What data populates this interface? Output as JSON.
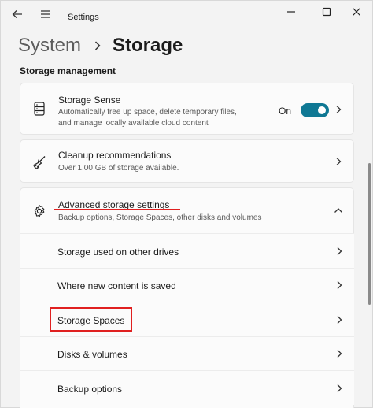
{
  "window": {
    "title": "Settings",
    "back_icon": "back-arrow-icon",
    "menu_icon": "hamburger-menu-icon",
    "controls": [
      "minimize-icon",
      "maximize-icon",
      "close-icon"
    ]
  },
  "breadcrumb": {
    "parent": "System",
    "current": "Storage"
  },
  "section": {
    "title": "Storage management"
  },
  "storage_sense": {
    "title": "Storage Sense",
    "desc_line1": "Automatically free up space, delete temporary files,",
    "desc_line2": "and manage locally available cloud content",
    "toggle_label": "On",
    "toggle_on": true,
    "icon": "storage-drive-icon"
  },
  "cleanup": {
    "title": "Cleanup recommendations",
    "desc": "Over 1.00 GB of storage available.",
    "icon": "broom-icon"
  },
  "advanced": {
    "title": "Advanced storage settings",
    "desc": "Backup options, Storage Spaces, other disks and volumes",
    "icon": "gear-icon",
    "expanded": true,
    "items": [
      {
        "label": "Storage used on other drives"
      },
      {
        "label": "Where new content is saved"
      },
      {
        "label": "Storage Spaces"
      },
      {
        "label": "Disks & volumes"
      },
      {
        "label": "Backup options"
      }
    ]
  },
  "colors": {
    "accent": "#0f7894",
    "highlight": "#e02020",
    "background": "#f3f3f3",
    "card": "#fbfbfb"
  }
}
